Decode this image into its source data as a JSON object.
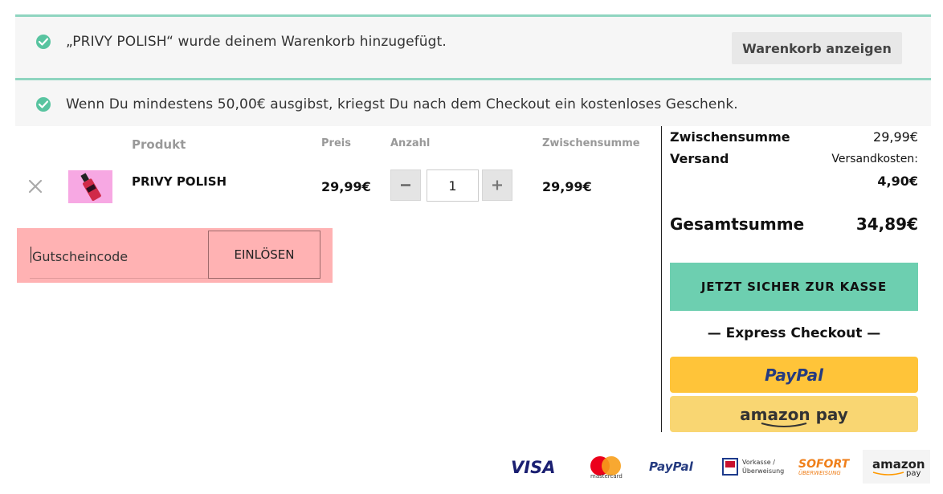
{
  "notices": [
    {
      "message": "„PRIVY POLISH“ wurde deinem Warenkorb hinzugefügt.",
      "button_label": "Warenkorb anzeigen"
    },
    {
      "message": "Wenn Du mindestens 50,00€ ausgibst, kriegst Du nach dem Checkout ein kostenloses Geschenk."
    }
  ],
  "cart_table": {
    "headers": {
      "product": "Produkt",
      "price": "Preis",
      "quantity": "Anzahl",
      "subtotal": "Zwischensumme"
    },
    "items": [
      {
        "name": "PRIVY POLISH",
        "price": "29,99€",
        "quantity": "1",
        "subtotal": "29,99€"
      }
    ]
  },
  "coupon": {
    "placeholder": "Gutscheincode",
    "button_label": "EINLÖSEN"
  },
  "summary": {
    "subtotal_label": "Zwischensumme",
    "subtotal_value": "29,99€",
    "shipping_label": "Versand",
    "shipping_text": "Versandkosten:",
    "shipping_value": "4,90€",
    "total_label": "Gesamtsumme",
    "total_value": "34,89€"
  },
  "checkout_button": "JETZT SICHER ZUR KASSE",
  "express_checkout": "— Express Checkout —",
  "express_buttons": {
    "paypal": "PayPal",
    "amazon": "amazon pay"
  },
  "payment_logos": {
    "visa": "VISA",
    "mastercard": "mastercard",
    "paypal": "PayPal",
    "ec_line1": "Vorkasse /",
    "ec_line2": "Überweisung",
    "sofort_line1": "SOFORT",
    "sofort_line2": "ÜBERWEISUNG",
    "amazon_line1": "amazon",
    "amazon_line2": "pay"
  },
  "colors": {
    "accent": "#6dcfb0",
    "notice_border": "#8fd5c0",
    "check": "#58c4a0",
    "paypal_yellow": "#ffc439",
    "amazon_yellow": "#f9d672",
    "highlight": "#ffb2b3"
  }
}
